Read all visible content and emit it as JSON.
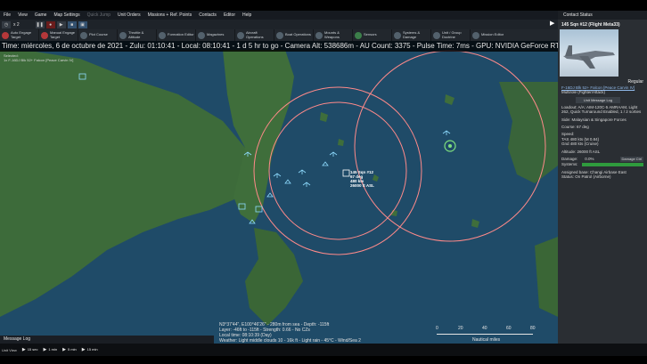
{
  "menu": [
    "File",
    "View",
    "Game",
    "Map Settings",
    "Quick Jump",
    "Unit Orders",
    "Missions + Ref. Points",
    "Contacts",
    "Editor",
    "Help"
  ],
  "toolbar": {
    "speed": "x 2"
  },
  "actions": [
    "Auto Engage Target",
    "Manual Engage Target",
    "Plot Course",
    "Throttle & Altitude",
    "Formation Editor",
    "Magazines",
    "Aircraft Operations",
    "Boat Operations",
    "Mounts & Weapons",
    "Sensors",
    "Systems & Damage",
    "Unit / Group Doctrine",
    "Mission Editor"
  ],
  "status": "Time: miércoles, 6 de octubre de 2021 - Zulu: 01:10:41 - Local: 08:10:41 - 1 d 5 hr to go -  Camera Alt: 538686m  - AU Count: 3375 - Pulse Time: 7ms - GPU: NVIDIA GeForce RTX 20",
  "selection": {
    "title": "Selected:",
    "item": "1x F-16DJ Blk 52+ Falcon [Peace Carvin IV]"
  },
  "unit_label": [
    "145 Sqn #12",
    "67 deg",
    "480 kts",
    "26000 ft ASL"
  ],
  "cursor_info": [
    "N3°37'44\", E100°46'26\" - 280m from sea - Depth: -115ft",
    "Layer: -46ft to -115ft - Strength: 0.66 - No CZs",
    "Local time: 08:10:39 (Day)",
    "Weather: Light middle clouds 10 - 16k ft - Light rain - 45°C - Wind/Sea 2"
  ],
  "scale": {
    "ticks": [
      "0",
      "20",
      "40",
      "60",
      "80"
    ],
    "unit": "Nautical miles"
  },
  "message_log": "Message Log",
  "bottom": {
    "label": "Unit View",
    "buttons": [
      "15 sec",
      "1 min",
      "5 min",
      "15 min"
    ]
  },
  "panel": {
    "header": "Contact Status",
    "title": "145 Sqn #12 (Flight Meta33)",
    "status": "Regular",
    "link": "F-16DJ Blk 52+ Falcon [Peace Carvin IV]",
    "role": "Multirole (Fighter/Attack)",
    "msg_button": "Unit Message Log",
    "loadout": "Loadout: A/A: AIM-120C-5 AMRAAM, Light 262, Quick Turnaround Enabled, 1 / 2 sorties",
    "side": "Side: Malaysian & Singapore Forces",
    "course": "Course: 67 deg",
    "speed": [
      "Speed:",
      "TAS 480 kts (M 0.84)",
      "Gnd 480 kts (Cruise)"
    ],
    "altitude": "Altitude: 26000 ft ASL",
    "damage_label": "Damage:",
    "damage_value": "0.0%",
    "damage_button": "Damage Ctrl",
    "systems_label": "Systems:",
    "assigned": "Assigned base: Changi Airbase East",
    "mission": "Status: On Patrol (Airborne)"
  },
  "colors": {
    "sea": "#1f4b68",
    "land": "#3d6b3a",
    "range_ring": "#ff8a8a",
    "friendly": "#8fdcff"
  },
  "icons": [
    "pause-icon",
    "play-icon",
    "record-icon",
    "nav-arrow-icon",
    "aircraft-icon"
  ]
}
